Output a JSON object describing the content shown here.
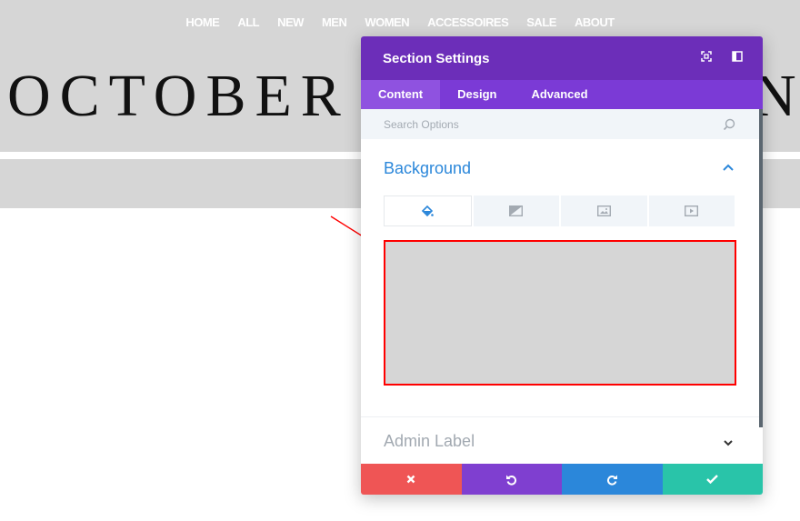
{
  "site": {
    "nav": [
      "HOME",
      "ALL",
      "NEW",
      "MEN",
      "WOMEN",
      "ACCESSOIRES",
      "SALE",
      "ABOUT"
    ],
    "logo_text": "OCTOBER",
    "logo_partial_end": "N"
  },
  "modal": {
    "title": "Section Settings",
    "header_icons": [
      "fullscreen-icon",
      "split-view-icon"
    ],
    "tabs": [
      {
        "label": "Content",
        "active": true
      },
      {
        "label": "Design",
        "active": false
      },
      {
        "label": "Advanced",
        "active": false
      }
    ],
    "search": {
      "placeholder": "Search Options"
    },
    "background": {
      "title": "Background",
      "expanded": true,
      "type_tabs": [
        {
          "icon": "paint-bucket-icon",
          "active": true
        },
        {
          "icon": "gradient-icon",
          "active": false
        },
        {
          "icon": "image-icon",
          "active": false
        },
        {
          "icon": "video-icon",
          "active": false
        }
      ],
      "color_preview": "#d6d6d6"
    },
    "admin_label": {
      "title": "Admin Label",
      "expanded": false
    },
    "footer": [
      {
        "action": "cancel",
        "icon": "close-icon",
        "color": "#ef5555"
      },
      {
        "action": "undo",
        "icon": "undo-icon",
        "color": "#7f3fd0"
      },
      {
        "action": "redo",
        "icon": "redo-icon",
        "color": "#2b87da"
      },
      {
        "action": "save",
        "icon": "check-icon",
        "color": "#29c4a9"
      }
    ]
  },
  "colors": {
    "header_purple": "#6c2eb9",
    "tab_purple": "#7b3ad6",
    "accent_blue": "#2b87da",
    "highlight_red": "#ff0000"
  }
}
